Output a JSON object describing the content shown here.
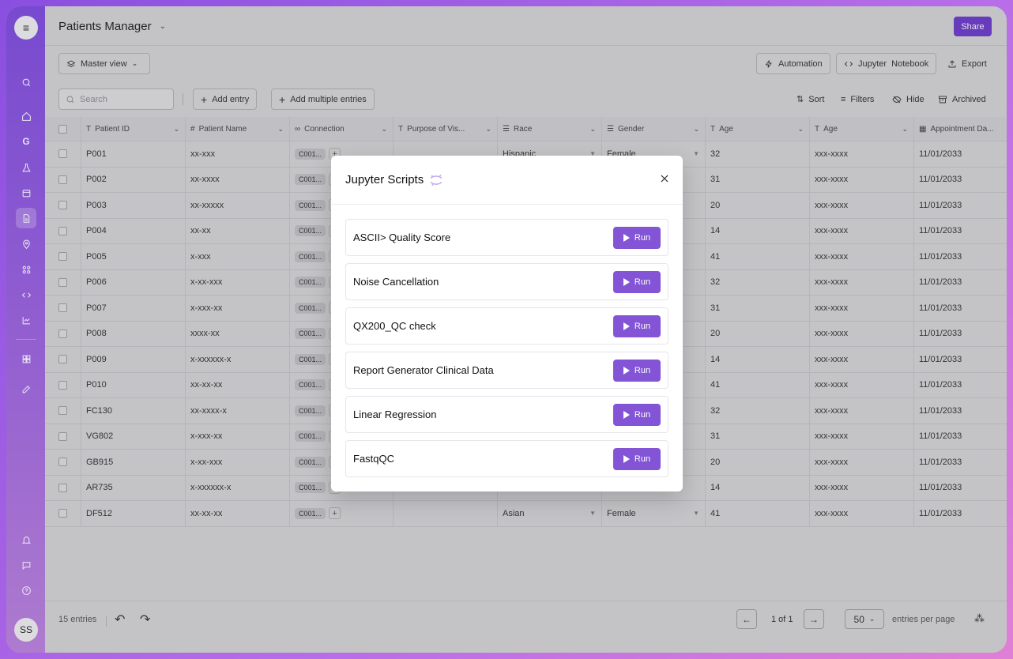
{
  "app": {
    "title": "Patients Manager",
    "share_label": "Share",
    "avatar_initials": "SS"
  },
  "toolbar": {
    "view_label": "Master view",
    "automation_label": "Automation",
    "jupyter_label": "Jupyter  Notebook",
    "export_label": "Export",
    "search_placeholder": "Search",
    "add_entry_label": "Add entry",
    "add_multiple_label": "Add multiple entries",
    "sort_label": "Sort",
    "filters_label": "Filters",
    "hide_label": "Hide",
    "archived_label": "Archived"
  },
  "table": {
    "columns": [
      "Patient ID",
      "Patient Name",
      "Connection",
      "Purpose of Vis...",
      "Race",
      "Gender",
      "Age",
      "Age",
      "Appointment Da..."
    ],
    "rows": [
      {
        "id": "P001",
        "name": "xx-xxx",
        "conn": "C001...",
        "race": "Hispanic",
        "gender": "Female",
        "age": "32",
        "age2": "xxx-xxxx",
        "date": "11/01/2033"
      },
      {
        "id": "P002",
        "name": "xx-xxxx",
        "conn": "C001...",
        "race": "",
        "gender": "",
        "age": "31",
        "age2": "xxx-xxxx",
        "date": "11/01/2033"
      },
      {
        "id": "P003",
        "name": "xx-xxxxx",
        "conn": "C001...",
        "race": "",
        "gender": "",
        "age": "20",
        "age2": "xxx-xxxx",
        "date": "11/01/2033"
      },
      {
        "id": "P004",
        "name": "xx-xx",
        "conn": "C001...",
        "race": "",
        "gender": "",
        "age": "14",
        "age2": "xxx-xxxx",
        "date": "11/01/2033"
      },
      {
        "id": "P005",
        "name": "x-xxx",
        "conn": "C001...",
        "race": "",
        "gender": "",
        "age": "41",
        "age2": "xxx-xxxx",
        "date": "11/01/2033"
      },
      {
        "id": "P006",
        "name": "x-xx-xxx",
        "conn": "C001...",
        "race": "",
        "gender": "",
        "age": "32",
        "age2": "xxx-xxxx",
        "date": "11/01/2033"
      },
      {
        "id": "P007",
        "name": "x-xxx-xx",
        "conn": "C001...",
        "race": "",
        "gender": "",
        "age": "31",
        "age2": "xxx-xxxx",
        "date": "11/01/2033"
      },
      {
        "id": "P008",
        "name": "xxxx-xx",
        "conn": "C001...",
        "race": "",
        "gender": "",
        "age": "20",
        "age2": "xxx-xxxx",
        "date": "11/01/2033"
      },
      {
        "id": "P009",
        "name": "x-xxxxxx-x",
        "conn": "C001...",
        "race": "",
        "gender": "",
        "age": "14",
        "age2": "xxx-xxxx",
        "date": "11/01/2033"
      },
      {
        "id": "P010",
        "name": "xx-xx-xx",
        "conn": "C001...",
        "race": "",
        "gender": "",
        "age": "41",
        "age2": "xxx-xxxx",
        "date": "11/01/2033"
      },
      {
        "id": "FC130",
        "name": "xx-xxxx-x",
        "conn": "C001...",
        "race": "",
        "gender": "",
        "age": "32",
        "age2": "xxx-xxxx",
        "date": "11/01/2033"
      },
      {
        "id": "VG802",
        "name": "x-xxx-xx",
        "conn": "C001...",
        "race": "",
        "gender": "",
        "age": "31",
        "age2": "xxx-xxxx",
        "date": "11/01/2033"
      },
      {
        "id": "GB915",
        "name": "x-xx-xxx",
        "conn": "C001...",
        "race": "",
        "gender": "",
        "age": "20",
        "age2": "xxx-xxxx",
        "date": "11/01/2033"
      },
      {
        "id": "AR735",
        "name": "x-xxxxxx-x",
        "conn": "C001...",
        "race": "",
        "gender": "",
        "age": "14",
        "age2": "xxx-xxxx",
        "date": "11/01/2033"
      },
      {
        "id": "DF512",
        "name": "xx-xx-xx",
        "conn": "C001...",
        "race": "Asian",
        "gender": "Female",
        "age": "41",
        "age2": "xxx-xxxx",
        "date": "11/01/2033"
      }
    ]
  },
  "footer": {
    "entries_label": "15 entries",
    "page_label": "1 of 1",
    "per_page_value": "50",
    "per_page_label": "entries per page"
  },
  "modal": {
    "title": "Jupyter Scripts",
    "run_label": "Run",
    "scripts": [
      "ASCII> Quality Score",
      "Noise Cancellation",
      "QX200_QC check",
      "Report Generator Clinical Data",
      "Linear Regression",
      "FastqQC"
    ]
  },
  "colors": {
    "accent": "#8355d6",
    "share": "#6a3cc4",
    "sidebar_top": "#7b4bd8",
    "sidebar_bottom": "#b57fd8"
  }
}
